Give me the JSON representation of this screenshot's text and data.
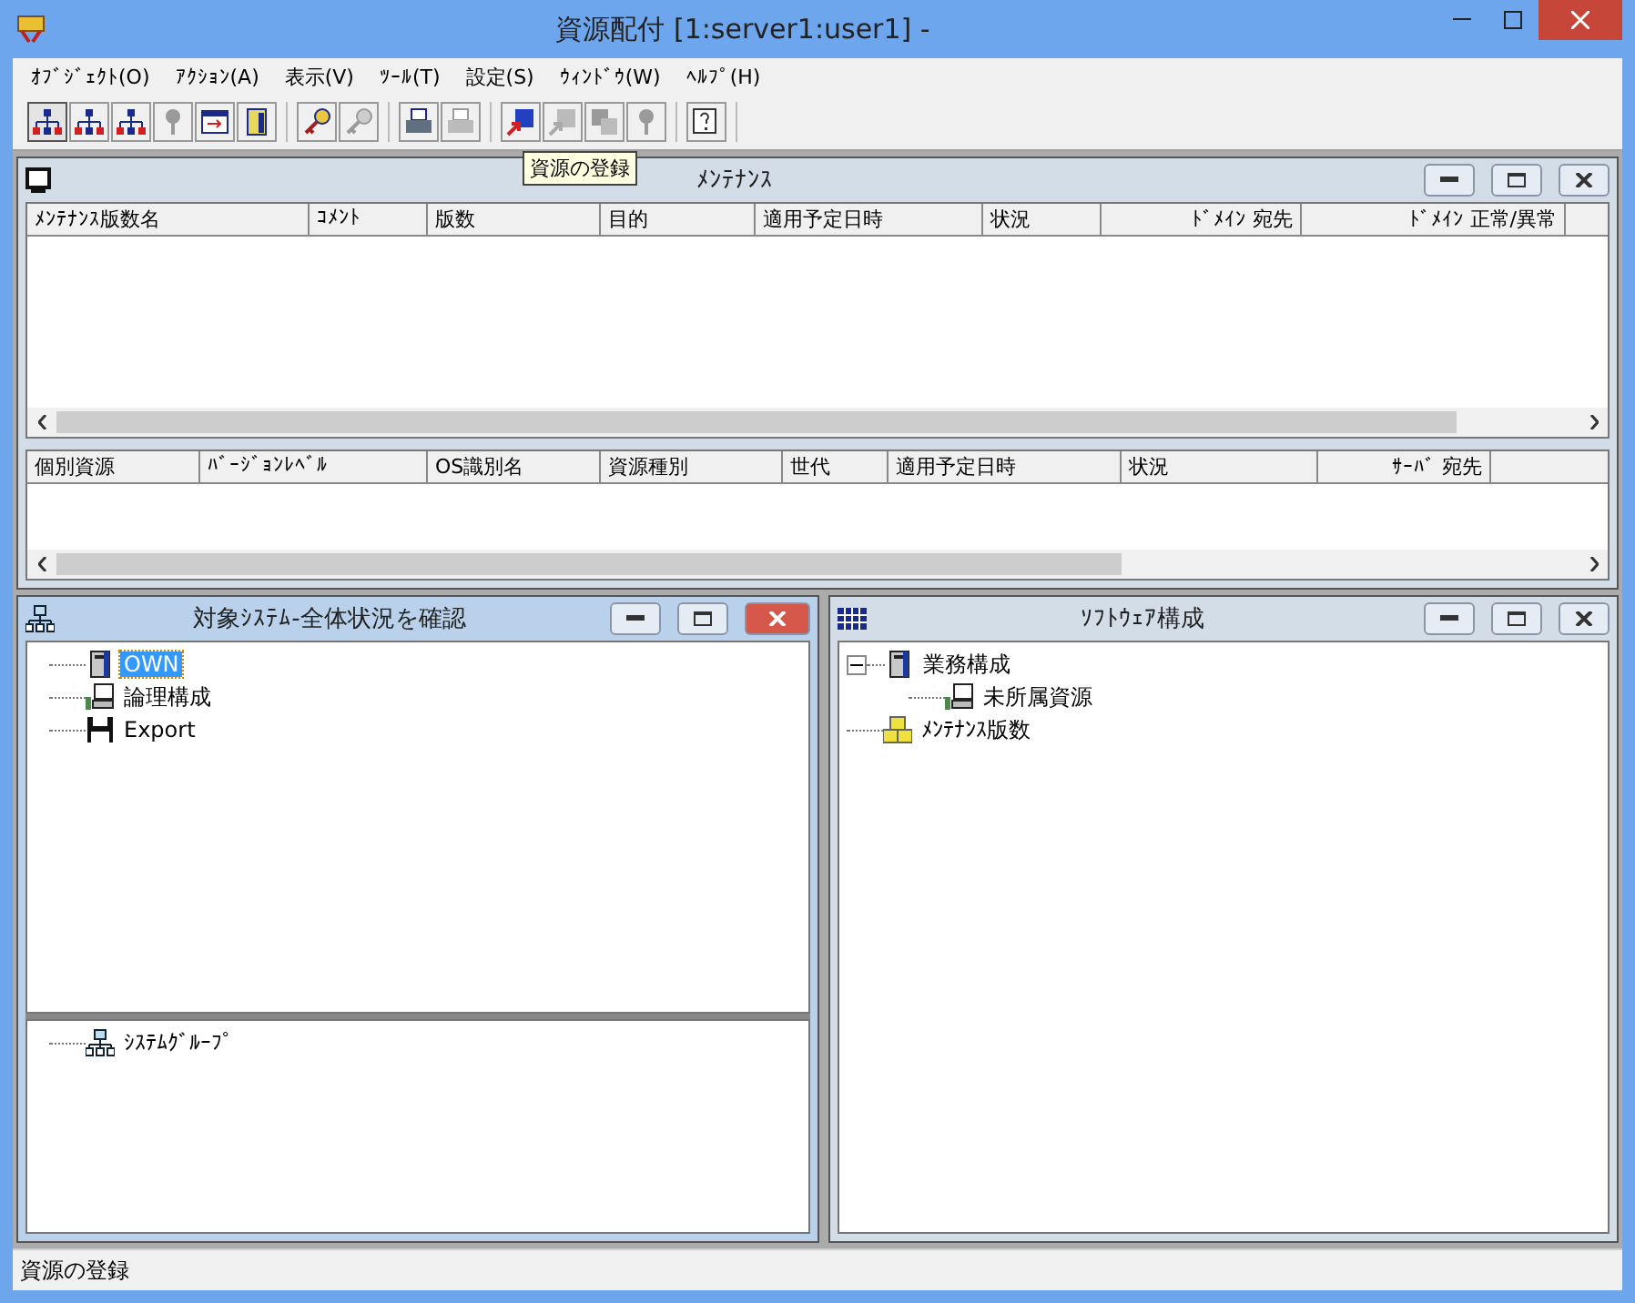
{
  "window": {
    "title": "資源配付 [1:server1:user1]  -"
  },
  "menu": [
    "ｵﾌﾞｼﾞｪｸﾄ(O)",
    "ｱｸｼｮﾝ(A)",
    "表示(V)",
    "ﾂｰﾙ(T)",
    "設定(S)",
    "ｳｨﾝﾄﾞｳ(W)",
    "ﾍﾙﾌﾟ(H)"
  ],
  "toolbar": [
    [
      {
        "kind": "network",
        "selected": true,
        "disabled": false
      },
      {
        "kind": "network",
        "selected": false,
        "disabled": false
      },
      {
        "kind": "network",
        "selected": false,
        "disabled": false
      },
      {
        "kind": "pin",
        "selected": false,
        "disabled": true
      },
      {
        "kind": "window",
        "selected": false,
        "disabled": false
      },
      {
        "kind": "door",
        "selected": false,
        "disabled": false
      }
    ],
    [
      {
        "kind": "key",
        "selected": false,
        "disabled": false
      },
      {
        "kind": "key",
        "selected": false,
        "disabled": true
      }
    ],
    [
      {
        "kind": "printer",
        "selected": false,
        "disabled": false
      },
      {
        "kind": "printer",
        "selected": false,
        "disabled": true
      }
    ],
    [
      {
        "kind": "import",
        "selected": false,
        "disabled": false
      },
      {
        "kind": "import",
        "selected": false,
        "disabled": true
      },
      {
        "kind": "stack",
        "selected": false,
        "disabled": true
      },
      {
        "kind": "pin",
        "selected": false,
        "disabled": true
      }
    ],
    [
      {
        "kind": "help",
        "selected": false,
        "disabled": false
      }
    ]
  ],
  "tooltip": "資源の登録",
  "maintenance": {
    "title": "ﾒﾝﾃﾅﾝｽ",
    "active": false,
    "upper_columns": [
      "ﾒﾝﾃﾅﾝｽ版数名",
      "ｺﾒﾝﾄ",
      "版数",
      "目的",
      "適用予定日時",
      "状況",
      "ﾄﾞﾒｲﾝ 宛先",
      "ﾄﾞﾒｲﾝ 正常/異常"
    ],
    "lower_columns": [
      "個別資源",
      "ﾊﾞｰｼﾞｮﾝﾚﾍﾞﾙ",
      "OS識別名",
      "資源種別",
      "世代",
      "適用予定日時",
      "状況",
      "ｻｰﾊﾞ 宛先"
    ]
  },
  "systems": {
    "title": "対象ｼｽﾃﾑ-全体状況を確認",
    "active": true,
    "items": [
      {
        "label": "OWN",
        "kind": "server",
        "selected": true
      },
      {
        "label": "論理構成",
        "kind": "computer",
        "selected": false
      },
      {
        "label": "Export",
        "kind": "disk",
        "selected": false
      }
    ],
    "groups": [
      {
        "label": "ｼｽﾃﾑｸﾞﾙｰﾌﾟ",
        "kind": "network",
        "selected": false
      }
    ]
  },
  "software": {
    "title": "ｿﾌﾄｳｪｱ構成",
    "active": false,
    "items": [
      {
        "label": "業務構成",
        "kind": "server",
        "selected": false,
        "expanded": true,
        "children": [
          {
            "label": "未所属資源",
            "kind": "computer",
            "selected": false
          }
        ]
      },
      {
        "label": "ﾒﾝﾃﾅﾝｽ版数",
        "kind": "boxes",
        "selected": false
      }
    ]
  },
  "status_bar": "資源の登録"
}
